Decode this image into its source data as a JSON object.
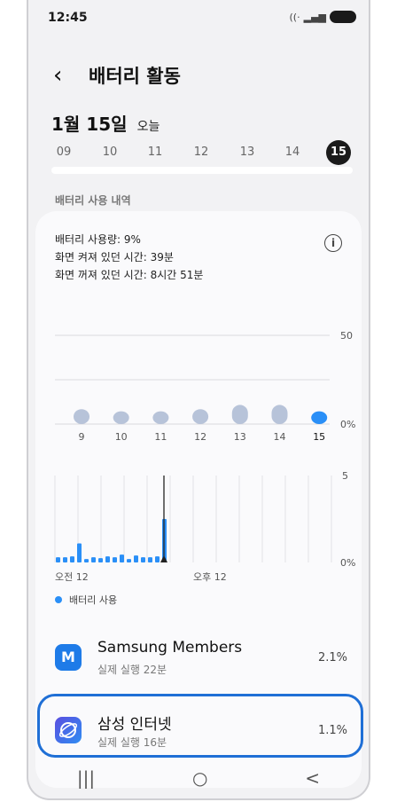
{
  "status": {
    "time": "12:45"
  },
  "header": {
    "title": "배터리 활동"
  },
  "date": {
    "day": "1월 15일",
    "today": "오늘"
  },
  "days": [
    "09",
    "10",
    "11",
    "12",
    "13",
    "14",
    "15"
  ],
  "selected_day": "15",
  "section_title": "배터리 사용 내역",
  "stats": {
    "usage": "배터리 사용량: 9%",
    "screen_on": "화면 켜져 있던 시간: 39분",
    "screen_off": "화면 꺼져 있던 시간: 8시간 51분"
  },
  "chart_data": [
    {
      "type": "bar",
      "categories": [
        "9",
        "10",
        "11",
        "12",
        "13",
        "14",
        "15"
      ],
      "values": [
        7,
        6,
        6,
        7,
        9,
        9,
        6
      ],
      "yaxis_labels": [
        "50",
        "0%"
      ],
      "highlight": "15"
    },
    {
      "type": "bar",
      "categories": [
        "오전 12",
        "오후 12"
      ],
      "yaxis_labels": [
        "5",
        "0%"
      ],
      "values": [
        0.3,
        0.3,
        0.35,
        1.1,
        0.2,
        0.3,
        0.25,
        0.35,
        0.3,
        0.45,
        0.2,
        0.4,
        0.3,
        0.3,
        0.35,
        2.5
      ]
    }
  ],
  "legend": {
    "label": "배터리 사용"
  },
  "apps": [
    {
      "name": "Samsung Members",
      "sub": "실제 실행 22분",
      "pct": "2.1%"
    },
    {
      "name": "삼성 인터넷",
      "sub": "실제 실행 16분",
      "pct": "1.1%"
    }
  ],
  "nav": {
    "recent": "|||",
    "home": "○",
    "back": "<"
  }
}
